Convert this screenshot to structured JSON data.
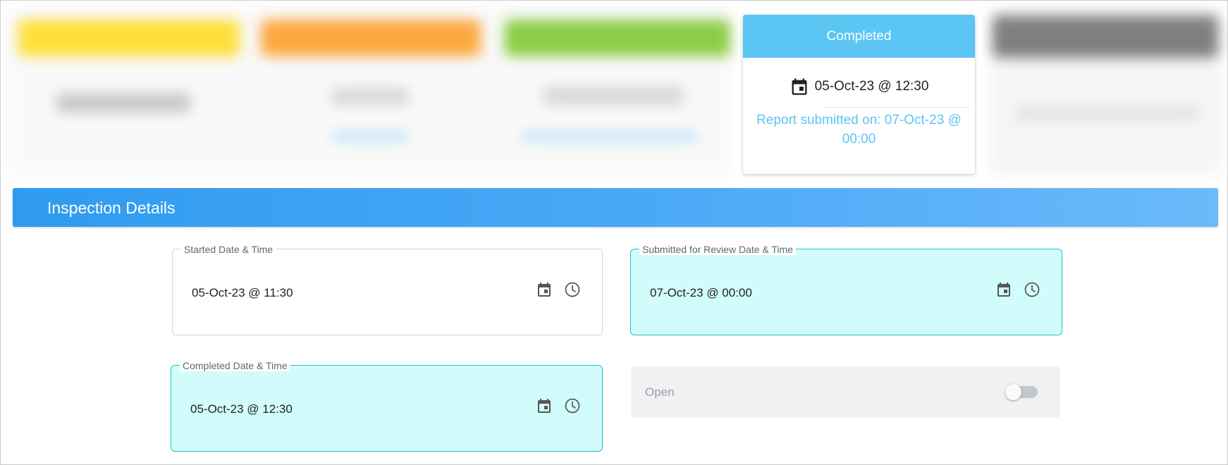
{
  "status_card": {
    "header": "Completed",
    "date": "05-Oct-23 @ 12:30",
    "date_icon": "calendar-icon",
    "report_line1": "Report submitted on: 07-Oct-23 @",
    "report_line2": "00:00",
    "accent": "#5bc5f4"
  },
  "section": {
    "title": "Inspection Details",
    "accent": "#2e9bf0"
  },
  "fields": {
    "started": {
      "label": "Started Date & Time",
      "value": "05-Oct-23 @ 11:30"
    },
    "submitted": {
      "label": "Submitted for Review Date & Time",
      "value": "07-Oct-23 @ 00:00"
    },
    "completed": {
      "label": "Completed Date & Time",
      "value": "05-Oct-23 @ 12:30"
    }
  },
  "toggle": {
    "label": "Open",
    "checked": false
  },
  "icons": {
    "calendar": "calendar-icon",
    "clock": "clock-icon"
  },
  "colors": {
    "highlight_bg": "#d2fcfc",
    "highlight_border": "#22c2c2"
  }
}
